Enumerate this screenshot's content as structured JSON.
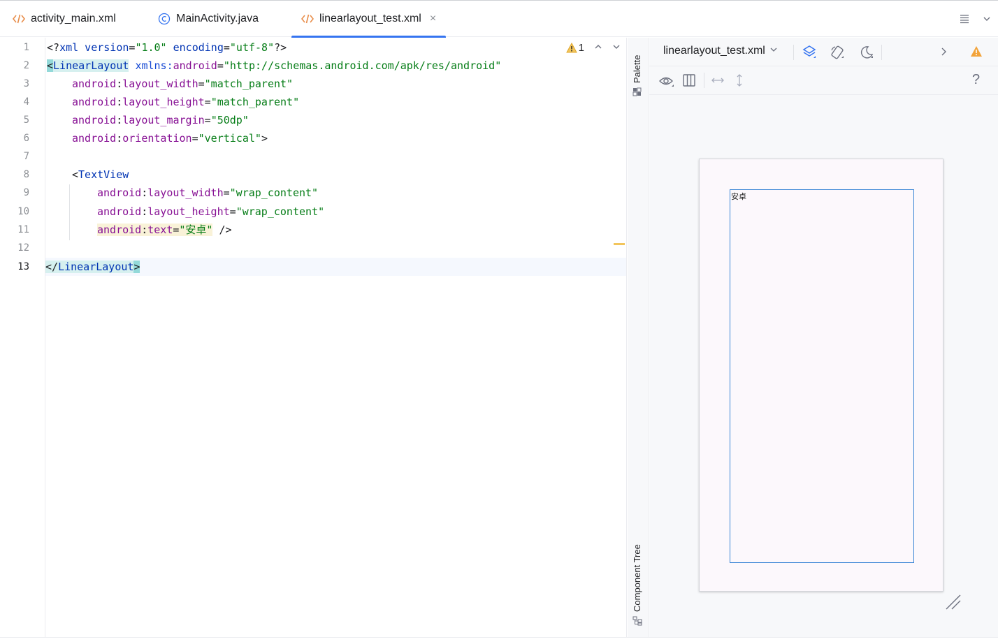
{
  "tabs": [
    {
      "label": "activity_main.xml",
      "icon": "xml-icon",
      "active": false
    },
    {
      "label": "MainActivity.java",
      "icon": "class-icon",
      "active": false
    },
    {
      "label": "linearlayout_test.xml",
      "icon": "xml-icon",
      "active": true
    }
  ],
  "tab_close_glyph": "×",
  "colors": {
    "accent": "#3574f0",
    "xml_icon": "#e88d4a",
    "warning": "#f2a33a"
  },
  "editor": {
    "line_numbers": [
      "1",
      "2",
      "3",
      "4",
      "5",
      "6",
      "7",
      "8",
      "9",
      "10",
      "11",
      "12",
      "13"
    ],
    "current_line": "13",
    "lines": {
      "l1": {
        "a": "<?",
        "b": "xml version",
        "c": "=",
        "d": "\"1.0\"",
        "e": " encoding",
        "f": "=",
        "g": "\"utf-8\"",
        "h": "?>"
      },
      "l2": {
        "a": "<",
        "b": "LinearLayout",
        "c": " ",
        "d": "xmlns:",
        "e": "android",
        "f": "=",
        "g": "\"http://schemas.android.com/apk/res/android\""
      },
      "l3": {
        "ns": "android",
        "colon": ":",
        "attr": "layout_width",
        "eq": "=",
        "val": "\"match_parent\""
      },
      "l4": {
        "ns": "android",
        "colon": ":",
        "attr": "layout_height",
        "eq": "=",
        "val": "\"match_parent\""
      },
      "l5": {
        "ns": "android",
        "colon": ":",
        "attr": "layout_margin",
        "eq": "=",
        "val": "\"50dp\""
      },
      "l6": {
        "ns": "android",
        "colon": ":",
        "attr": "orientation",
        "eq": "=",
        "val": "\"vertical\"",
        "end": ">"
      },
      "l8": {
        "a": "<",
        "b": "TextView"
      },
      "l9": {
        "ns": "android",
        "colon": ":",
        "attr": "layout_width",
        "eq": "=",
        "val": "\"wrap_content\""
      },
      "l10": {
        "ns": "android",
        "colon": ":",
        "attr": "layout_height",
        "eq": "=",
        "val": "\"wrap_content\""
      },
      "l11": {
        "ns": "android",
        "colon": ":",
        "attr": "text",
        "eq": "=",
        "val": "\"安卓\"",
        "end": " />"
      },
      "l13": {
        "a": "</",
        "b": "LinearLayout",
        "c": ">"
      }
    },
    "inspection": {
      "warning_count": "1"
    }
  },
  "sidestrip": {
    "palette": "Palette",
    "component_tree": "Component Tree"
  },
  "design": {
    "file_name": "linearlayout_test.xml",
    "toolbar1_icons": [
      "design-surface-icon",
      "orientation-icon",
      "night-mode-icon",
      "chevron-right-icon",
      "warning-icon"
    ],
    "toolbar2_icons": [
      "eye-icon",
      "columns-icon",
      "horizontal-resize-icon",
      "vertical-resize-icon",
      "help-icon"
    ],
    "help_glyph": "?",
    "preview_text": "安卓"
  }
}
